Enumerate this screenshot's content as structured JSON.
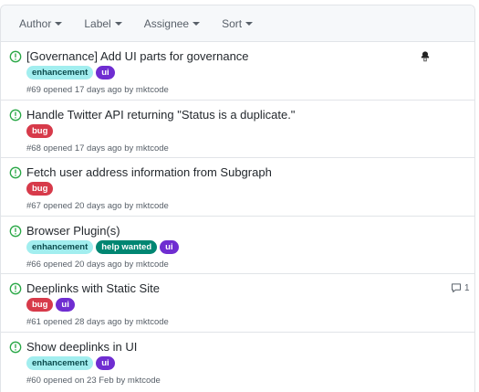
{
  "filters": [
    {
      "label": "Author"
    },
    {
      "label": "Label"
    },
    {
      "label": "Assignee"
    },
    {
      "label": "Sort"
    }
  ],
  "colors": {
    "open_green": "#28a745",
    "enhancement_bg": "#a2eeef",
    "enhancement_fg": "#0b4a4c",
    "ui_bg": "#6f2dd1",
    "bug_bg": "#d73a4a",
    "help_wanted_bg": "#008672",
    "label_fg_light": "#ffffff"
  },
  "issues": [
    {
      "title": "[Governance] Add UI parts for governance",
      "labels": [
        {
          "name": "enhancement",
          "kind": "enhancement"
        },
        {
          "name": "ui",
          "kind": "ui"
        }
      ],
      "meta": "#69 opened 17 days ago by mktcode",
      "assignee_avatar": "avatar-icon",
      "comments": null
    },
    {
      "title": "Handle Twitter API returning \"Status is a duplicate.\"",
      "labels": [
        {
          "name": "bug",
          "kind": "bug"
        }
      ],
      "meta": "#68 opened 17 days ago by mktcode",
      "comments": null
    },
    {
      "title": "Fetch user address information from Subgraph",
      "labels": [
        {
          "name": "bug",
          "kind": "bug"
        }
      ],
      "meta": "#67 opened 20 days ago by mktcode",
      "comments": null
    },
    {
      "title": "Browser Plugin(s)",
      "labels": [
        {
          "name": "enhancement",
          "kind": "enhancement"
        },
        {
          "name": "help wanted",
          "kind": "help"
        },
        {
          "name": "ui",
          "kind": "ui"
        }
      ],
      "meta": "#66 opened 20 days ago by mktcode",
      "comments": null
    },
    {
      "title": "Deeplinks with Static Site",
      "labels": [
        {
          "name": "bug",
          "kind": "bug"
        },
        {
          "name": "ui",
          "kind": "ui"
        }
      ],
      "meta": "#61 opened 28 days ago by mktcode",
      "comments": "1"
    },
    {
      "title": "Show deeplinks in UI",
      "labels": [
        {
          "name": "enhancement",
          "kind": "enhancement"
        },
        {
          "name": "ui",
          "kind": "ui"
        }
      ],
      "meta": "#60 opened on 23 Feb by mktcode",
      "comments": null
    }
  ]
}
